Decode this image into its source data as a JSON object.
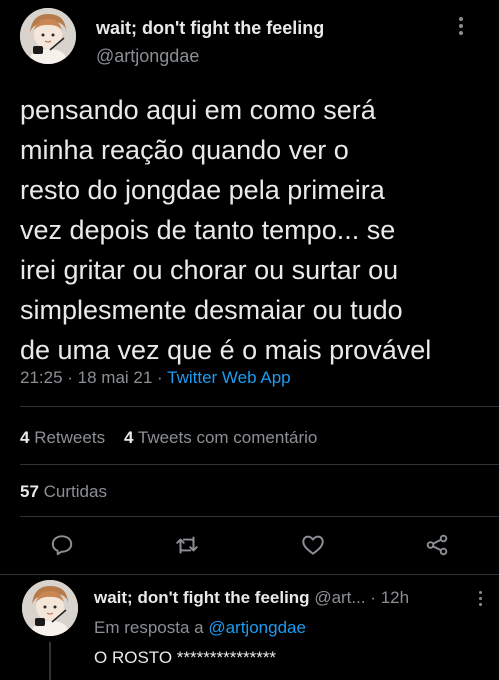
{
  "tweet": {
    "author": {
      "display_name": "wait; don't fight the feeling",
      "handle": "@artjongdae"
    },
    "text": "pensando aqui em como será\nminha reação quando ver o\nresto do jongdae pela primeira\nvez depois de tanto tempo... se\nirei gritar ou chorar ou surtar ou\nsimplesmente desmaiar ou tudo\nde uma vez que é o mais provável",
    "time": "21:25",
    "sep1": " · ",
    "date": "18 mai 21",
    "sep2": " · ",
    "source": "Twitter Web App"
  },
  "stats": {
    "retweets_count": "4",
    "retweets_label": "Retweets",
    "quotes_count": "4",
    "quotes_label": "Tweets com comentário",
    "likes_count": "57",
    "likes_label": "Curtidas"
  },
  "actions": [
    "reply-icon",
    "retweet-icon",
    "like-icon",
    "share-icon"
  ],
  "reply": {
    "display_name": "wait; don't fight the feeling",
    "handle_truncated": "@art...",
    "sep": " · ",
    "time": "12h",
    "replying_prefix": "Em resposta a ",
    "replying_to": "@artjongdae",
    "text": "O ROSTO ***************"
  },
  "colors": {
    "background": "#000000",
    "text": "#e7e9ea",
    "secondary": "#8b8f94",
    "accent": "#1d9bf0",
    "divider": "#2f3336"
  }
}
